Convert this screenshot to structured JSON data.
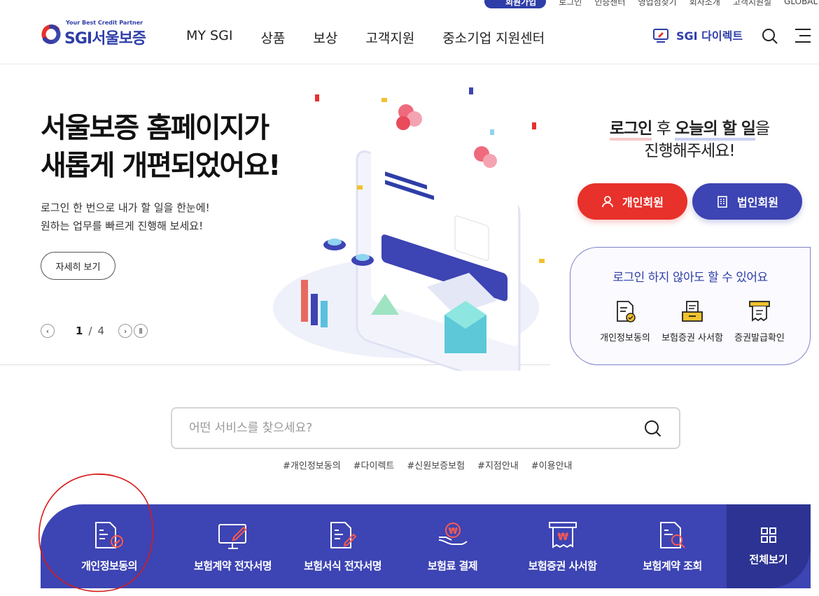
{
  "util": {
    "join_label": "회원가입",
    "links": [
      "로그인",
      "인증센터",
      "영업점찾기",
      "회사소개",
      "고객지원실"
    ],
    "global_label": "GLOBAL"
  },
  "header": {
    "logo_tagline": "Your Best Credit Partner",
    "logo_text": "SGI서울보증",
    "nav": [
      "MY SGI",
      "상품",
      "보상",
      "고객지원",
      "중소기업 지원센터"
    ],
    "direct_label": "SGI 다이렉트"
  },
  "hero": {
    "title_line1": "서울보증 홈페이지가",
    "title_line2": "새롭게 개편되었어요!",
    "desc_line1": "로그인 한 번으로 내가 할 일을 한눈에!",
    "desc_line2": "원하는 업무를 빠르게 진행해 보세요!",
    "detail_button": "자세히 보기",
    "pager_current": "1",
    "pager_sep": "/",
    "pager_total": "4"
  },
  "login": {
    "msg_a": "로그인",
    "msg_b": " 후 ",
    "msg_c": "오늘의 할 일",
    "msg_d": "을",
    "msg_line2": "진행해주세요!",
    "personal_label": "개인회원",
    "corporate_label": "법인회원",
    "guest_title": "로그인 하지 않아도 할 수 있어요",
    "guest_items": [
      "개인정보동의",
      "보험증권 사서함",
      "증권발급확인"
    ]
  },
  "search": {
    "placeholder": "어떤 서비스를 찾으세요?",
    "tags": [
      "#개인정보동의",
      "#다이렉트",
      "#신원보증보험",
      "#지점안내",
      "#이용안내"
    ]
  },
  "quick": {
    "items": [
      "개인정보동의",
      "보험계약 전자서명",
      "보험서식 전자서명",
      "보험료 결제",
      "보험증권 사서함",
      "보험계약 조회"
    ],
    "all_label": "전체보기"
  },
  "colors": {
    "brand_blue": "#2e3ea8",
    "quick_bg": "#3d44b3",
    "red": "#e7312a",
    "annotation": "#d81b1b"
  }
}
